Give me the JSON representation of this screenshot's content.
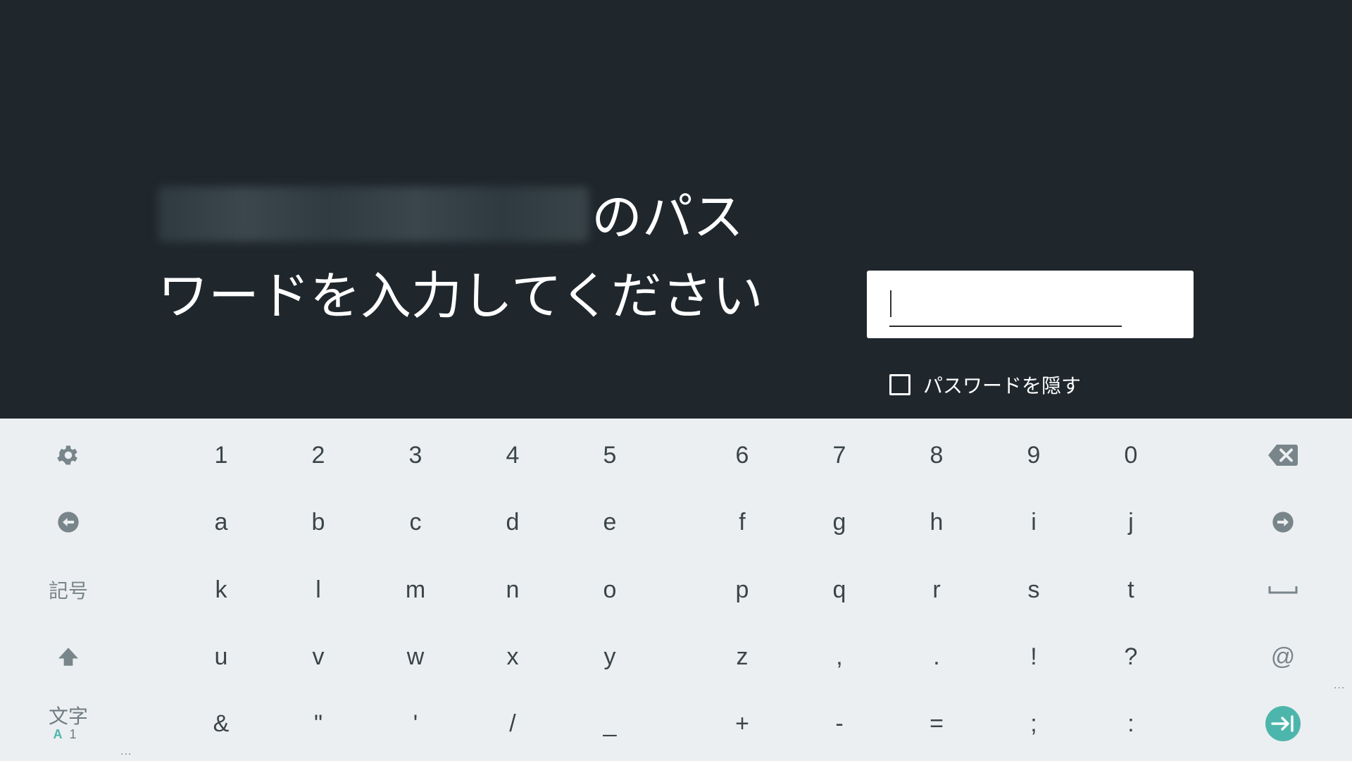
{
  "prompt": {
    "network_name": "",
    "title_suffix": "のパスワードを入力してください",
    "password_value": "",
    "hide_password_label": "パスワードを隠す",
    "hide_password_checked": false
  },
  "keyboard": {
    "rows": [
      [
        "1",
        "2",
        "3",
        "4",
        "5",
        "6",
        "7",
        "8",
        "9",
        "0"
      ],
      [
        "a",
        "b",
        "c",
        "d",
        "e",
        "f",
        "g",
        "h",
        "i",
        "j"
      ],
      [
        "k",
        "l",
        "m",
        "n",
        "o",
        "p",
        "q",
        "r",
        "s",
        "t"
      ],
      [
        "u",
        "v",
        "w",
        "x",
        "y",
        "z",
        ",",
        ".",
        "!",
        "?"
      ],
      [
        "&",
        "\"",
        "'",
        "/",
        "_",
        "+",
        "-",
        "=",
        ";",
        ":"
      ]
    ],
    "left_keys": {
      "settings_icon": "gear-icon",
      "back_icon": "arrow-left-circle-icon",
      "symbols_label": "記号",
      "shift_icon": "shift-up-arrow-icon",
      "language_main": "文字",
      "language_sub_a": "A",
      "language_sub_1": "1"
    },
    "right_keys": {
      "backspace_icon": "backspace-icon",
      "forward_icon": "arrow-right-circle-icon",
      "space_icon": "space-bar-icon",
      "at_label": "@",
      "enter_icon": "enter-next-icon"
    },
    "more_indicator": "..."
  },
  "colors": {
    "background": "#1f272d",
    "keyboard_bg": "#eceff1",
    "key_text": "#3b4449",
    "function_key": "#78858b",
    "accent": "#4db6ac"
  }
}
